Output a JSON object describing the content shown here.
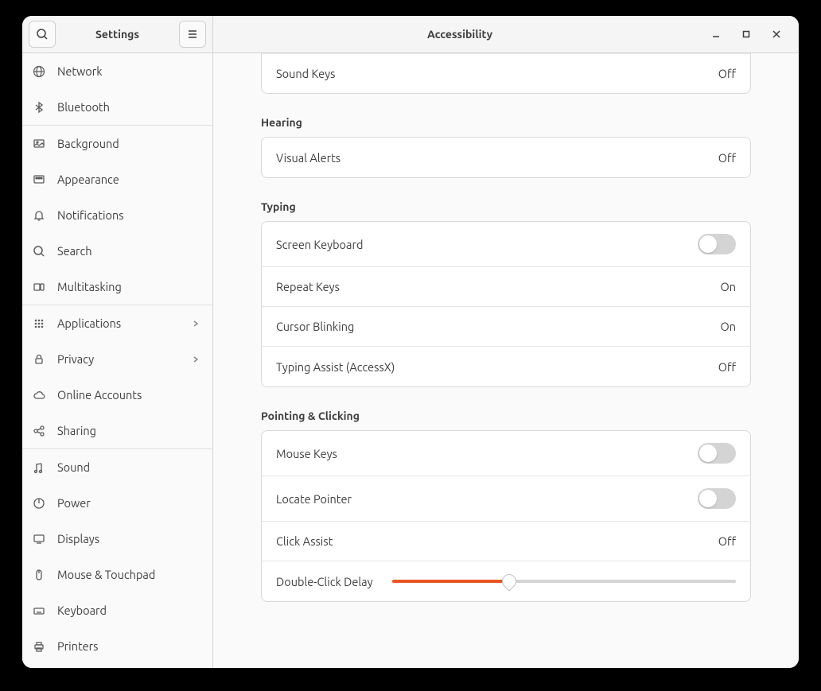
{
  "titlebar": {
    "left_title": "Settings",
    "right_title": "Accessibility"
  },
  "sidebar": {
    "items": [
      {
        "label": "Network",
        "icon": "globe"
      },
      {
        "label": "Bluetooth",
        "icon": "bluetooth"
      },
      {
        "sep": true
      },
      {
        "label": "Background",
        "icon": "background"
      },
      {
        "label": "Appearance",
        "icon": "appearance"
      },
      {
        "label": "Notifications",
        "icon": "bell"
      },
      {
        "label": "Search",
        "icon": "search"
      },
      {
        "label": "Multitasking",
        "icon": "multitask"
      },
      {
        "sep": true
      },
      {
        "label": "Applications",
        "icon": "grid",
        "chevron": true
      },
      {
        "label": "Privacy",
        "icon": "lock",
        "chevron": true
      },
      {
        "label": "Online Accounts",
        "icon": "cloud"
      },
      {
        "label": "Sharing",
        "icon": "share"
      },
      {
        "sep": true
      },
      {
        "label": "Sound",
        "icon": "sound"
      },
      {
        "label": "Power",
        "icon": "power"
      },
      {
        "label": "Displays",
        "icon": "display"
      },
      {
        "label": "Mouse & Touchpad",
        "icon": "mouse"
      },
      {
        "label": "Keyboard",
        "icon": "keyboard"
      },
      {
        "label": "Printers",
        "icon": "printer"
      }
    ]
  },
  "sections": {
    "partial_top": {
      "rows": [
        {
          "label": "Sound Keys",
          "value": "Off"
        }
      ]
    },
    "hearing": {
      "title": "Hearing",
      "rows": [
        {
          "label": "Visual Alerts",
          "value": "Off"
        }
      ]
    },
    "typing": {
      "title": "Typing",
      "rows": [
        {
          "label": "Screen Keyboard",
          "toggle": false
        },
        {
          "label": "Repeat Keys",
          "value": "On"
        },
        {
          "label": "Cursor Blinking",
          "value": "On"
        },
        {
          "label": "Typing Assist (AccessX)",
          "value": "Off"
        }
      ]
    },
    "pointing": {
      "title": "Pointing & Clicking",
      "rows": [
        {
          "label": "Mouse Keys",
          "toggle": false
        },
        {
          "label": "Locate Pointer",
          "toggle": false
        },
        {
          "label": "Click Assist",
          "value": "Off"
        },
        {
          "label": "Double-Click Delay",
          "slider": 34
        }
      ]
    }
  }
}
